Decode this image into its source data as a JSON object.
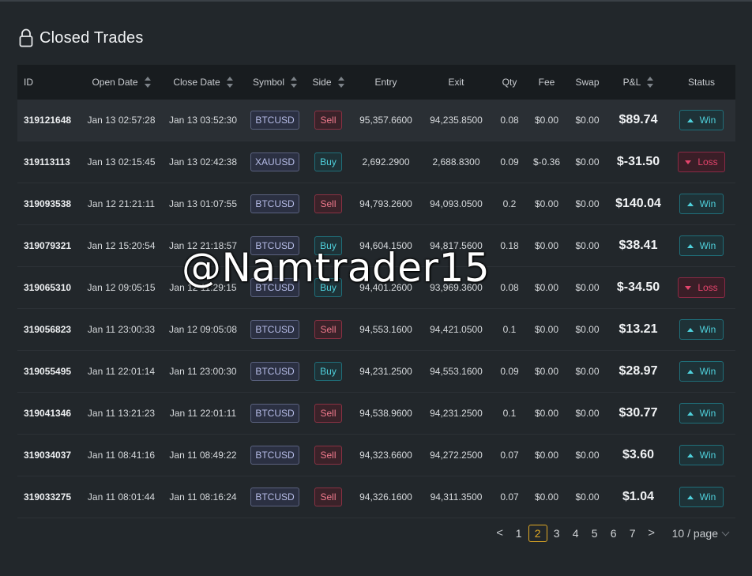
{
  "page": {
    "title": "Closed Trades"
  },
  "table": {
    "columns": {
      "id": "ID",
      "open_date": "Open Date",
      "close_date": "Close Date",
      "symbol": "Symbol",
      "side": "Side",
      "entry": "Entry",
      "exit": "Exit",
      "qty": "Qty",
      "fee": "Fee",
      "swap": "Swap",
      "pnl": "P&L",
      "status": "Status"
    },
    "rows": [
      {
        "id": "319121648",
        "open": "Jan 13 02:57:28",
        "close": "Jan 13 03:52:30",
        "symbol": "BTCUSD",
        "side": "Sell",
        "entry": "95,357.6600",
        "exit": "94,235.8500",
        "qty": "0.08",
        "fee": "$0.00",
        "swap": "$0.00",
        "pnl": "$89.74",
        "status": "Win"
      },
      {
        "id": "319113113",
        "open": "Jan 13 02:15:45",
        "close": "Jan 13 02:42:38",
        "symbol": "XAUUSD",
        "side": "Buy",
        "entry": "2,692.2900",
        "exit": "2,688.8300",
        "qty": "0.09",
        "fee": "$-0.36",
        "swap": "$0.00",
        "pnl": "$-31.50",
        "status": "Loss"
      },
      {
        "id": "319093538",
        "open": "Jan 12 21:21:11",
        "close": "Jan 13 01:07:55",
        "symbol": "BTCUSD",
        "side": "Sell",
        "entry": "94,793.2600",
        "exit": "94,093.0500",
        "qty": "0.2",
        "fee": "$0.00",
        "swap": "$0.00",
        "pnl": "$140.04",
        "status": "Win"
      },
      {
        "id": "319079321",
        "open": "Jan 12 15:20:54",
        "close": "Jan 12 21:18:57",
        "symbol": "BTCUSD",
        "side": "Buy",
        "entry": "94,604.1500",
        "exit": "94,817.5600",
        "qty": "0.18",
        "fee": "$0.00",
        "swap": "$0.00",
        "pnl": "$38.41",
        "status": "Win"
      },
      {
        "id": "319065310",
        "open": "Jan 12 09:05:15",
        "close": "Jan 12 11:29:15",
        "symbol": "BTCUSD",
        "side": "Buy",
        "entry": "94,401.2600",
        "exit": "93,969.3600",
        "qty": "0.08",
        "fee": "$0.00",
        "swap": "$0.00",
        "pnl": "$-34.50",
        "status": "Loss"
      },
      {
        "id": "319056823",
        "open": "Jan 11 23:00:33",
        "close": "Jan 12 09:05:08",
        "symbol": "BTCUSD",
        "side": "Sell",
        "entry": "94,553.1600",
        "exit": "94,421.0500",
        "qty": "0.1",
        "fee": "$0.00",
        "swap": "$0.00",
        "pnl": "$13.21",
        "status": "Win"
      },
      {
        "id": "319055495",
        "open": "Jan 11 22:01:14",
        "close": "Jan 11 23:00:30",
        "symbol": "BTCUSD",
        "side": "Buy",
        "entry": "94,231.2500",
        "exit": "94,553.1600",
        "qty": "0.09",
        "fee": "$0.00",
        "swap": "$0.00",
        "pnl": "$28.97",
        "status": "Win"
      },
      {
        "id": "319041346",
        "open": "Jan 11 13:21:23",
        "close": "Jan 11 22:01:11",
        "symbol": "BTCUSD",
        "side": "Sell",
        "entry": "94,538.9600",
        "exit": "94,231.2500",
        "qty": "0.1",
        "fee": "$0.00",
        "swap": "$0.00",
        "pnl": "$30.77",
        "status": "Win"
      },
      {
        "id": "319034037",
        "open": "Jan 11 08:41:16",
        "close": "Jan 11 08:49:22",
        "symbol": "BTCUSD",
        "side": "Sell",
        "entry": "94,323.6600",
        "exit": "94,272.2500",
        "qty": "0.07",
        "fee": "$0.00",
        "swap": "$0.00",
        "pnl": "$3.60",
        "status": "Win"
      },
      {
        "id": "319033275",
        "open": "Jan 11 08:01:44",
        "close": "Jan 11 08:16:24",
        "symbol": "BTCUSD",
        "side": "Sell",
        "entry": "94,326.1600",
        "exit": "94,311.3500",
        "qty": "0.07",
        "fee": "$0.00",
        "swap": "$0.00",
        "pnl": "$1.04",
        "status": "Win"
      }
    ]
  },
  "pagination": {
    "prev": "<",
    "next": ">",
    "pages": [
      "1",
      "2",
      "3",
      "4",
      "5",
      "6",
      "7"
    ],
    "current": "2",
    "page_size": "10 / page"
  },
  "watermark": "@Namtrader15",
  "colors": {
    "win": "#4fd1dc",
    "loss": "#e5446c",
    "active_page": "#e0a925"
  }
}
